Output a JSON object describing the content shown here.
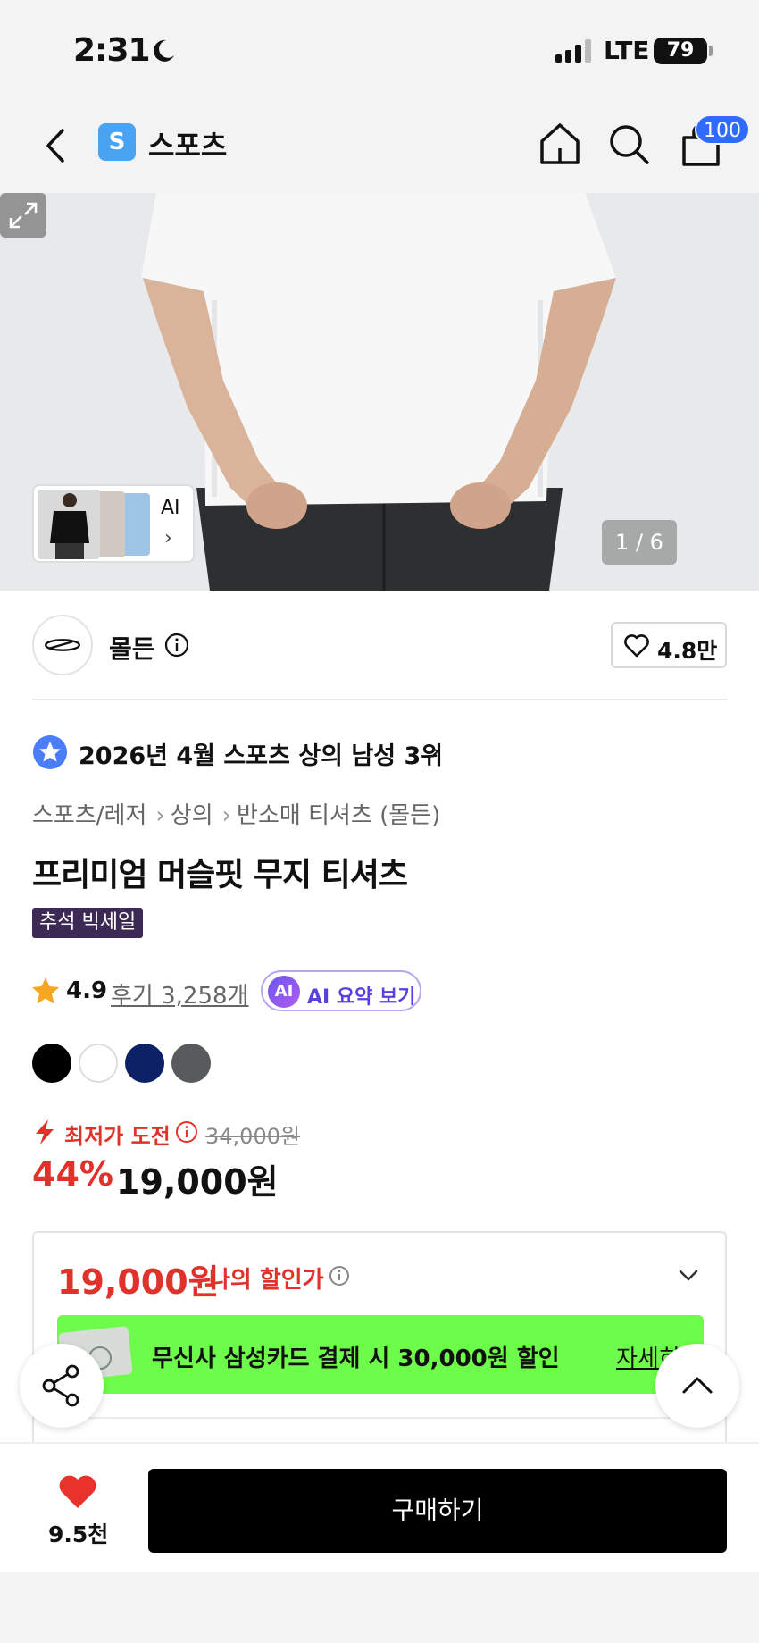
{
  "status_bar": {
    "time": "2:31",
    "network": "LTE",
    "battery": "79"
  },
  "nav": {
    "category_badge": "S",
    "category_title": "스포츠",
    "cart_count": "100"
  },
  "gallery": {
    "ai_label": "AI",
    "ai_arrow": "›",
    "counter": "1 / 6"
  },
  "brand": {
    "name": "몰든",
    "likes": "4.8만"
  },
  "ranking": {
    "text": "2026년 4월 스포츠 상의 남성 3위",
    "arrow": "›"
  },
  "breadcrumb": {
    "items": [
      "스포츠/레저",
      "상의",
      "반소매 티셔츠 (몰든)"
    ],
    "separator": "›"
  },
  "product": {
    "title": "프리미엄 머슬핏 무지 티셔츠",
    "sale_tag": "추석 빅세일",
    "rating": "4.9",
    "reviews": "후기 3,258개",
    "ai_summary_badge": "AI",
    "ai_summary_label": "AI 요약 보기",
    "colors": [
      "#000000",
      "#ffffff",
      "#0d2266",
      "#595a5c"
    ],
    "lowest_price_label": "최저가 도전",
    "original_price": "34,000원",
    "discount_rate": "44%",
    "sale_price": "19,000원"
  },
  "price_box": {
    "my_price": "19,000원",
    "my_price_label": "나의 할인가",
    "card_banner_prefix": "무신사 삼성카드 결제 시 ",
    "card_banner_amount": "30,000원 할인",
    "card_banner_more": "자세히"
  },
  "bottom_bar": {
    "wish_count": "9.5천",
    "buy_label": "구매하기"
  },
  "colors": {
    "accent_red": "#e0322b",
    "badge_blue": "#2f6bff",
    "banner_green": "#6dfc4a"
  }
}
